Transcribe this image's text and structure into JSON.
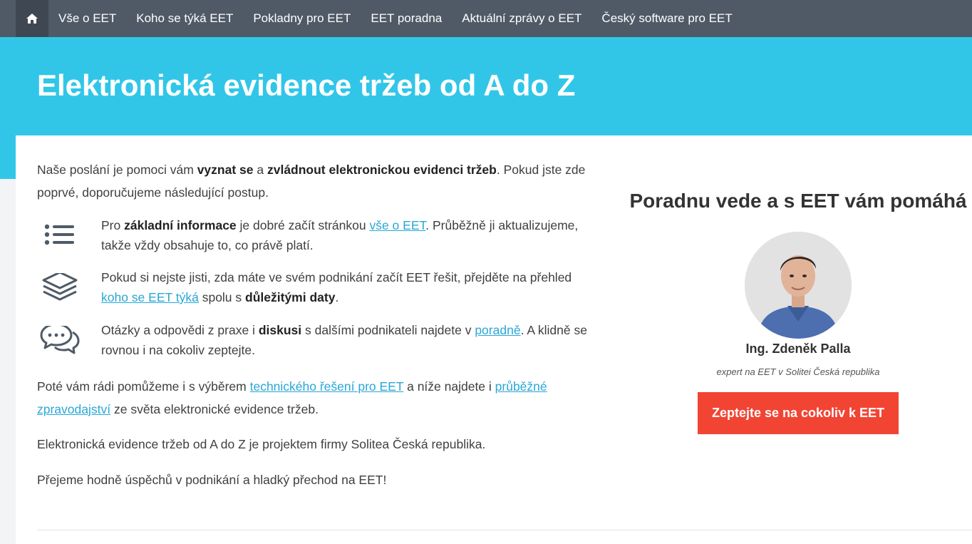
{
  "nav": {
    "home_icon": "home-icon",
    "items": [
      {
        "label": "Vše o EET"
      },
      {
        "label": "Koho se týká EET"
      },
      {
        "label": "Pokladny pro EET"
      },
      {
        "label": "EET poradna"
      },
      {
        "label": "Aktuální zprávy o EET"
      },
      {
        "label": "Český software pro EET"
      }
    ]
  },
  "hero": {
    "title": "Elektronická evidence tržeb od A do Z"
  },
  "intro": {
    "t1": "Naše poslání je pomoci vám ",
    "b1": "vyznat se",
    "t2": " a ",
    "b2": "zvládnout elektronickou evidenci tržeb",
    "t3": ". Pokud jste zde poprvé, doporučujeme následující postup."
  },
  "steps": [
    {
      "icon": "list-icon",
      "t1": "Pro ",
      "b1": "základní informace",
      "t2": " je dobré začít stránkou ",
      "link": "vše o EET",
      "t3": ". Průběžně ji aktualizujeme, takže vždy obsahuje to, co právě platí."
    },
    {
      "icon": "layers-icon",
      "t1": "Pokud si nejste jisti, zda máte ve svém podnikání začít EET řešit, přejděte na přehled ",
      "link": "koho se EET týká",
      "t2": " spolu s ",
      "b1": "důležitými daty",
      "t3": "."
    },
    {
      "icon": "chat-bubbles-icon",
      "t1": "Otázky a odpovědi z praxe i ",
      "b1": "diskusi",
      "t2": " s dalšími podnikateli najdete v ",
      "link": "poradně",
      "t3": ". A klidně se rovnou i na cokoliv zeptejte."
    }
  ],
  "para1": {
    "t1": "Poté vám rádi pomůžeme i s výběrem ",
    "link1": "technického řešení pro EET",
    "t2": " a níže najdete i ",
    "link2": "průběžné zpravodajství",
    "t3": " ze světa elektronické evidence tržeb."
  },
  "para2": "Elektronická evidence tržeb od A do Z je projektem firmy Solitea Česká republika.",
  "para3": "Přejeme hodně úspěchů v podnikání a hladký přechod na EET!",
  "sidebar": {
    "heading": "Poradnu vede a s EET vám pomáhá",
    "name": "Ing. Zdeněk Palla",
    "role": "expert na EET v Solitei Česká republika",
    "cta": "Zeptejte se na cokoliv k EET"
  },
  "colors": {
    "nav_bg": "#505a66",
    "hero_bg": "#31c6e8",
    "link": "#2aa7d6",
    "cta_bg": "#f24433"
  }
}
